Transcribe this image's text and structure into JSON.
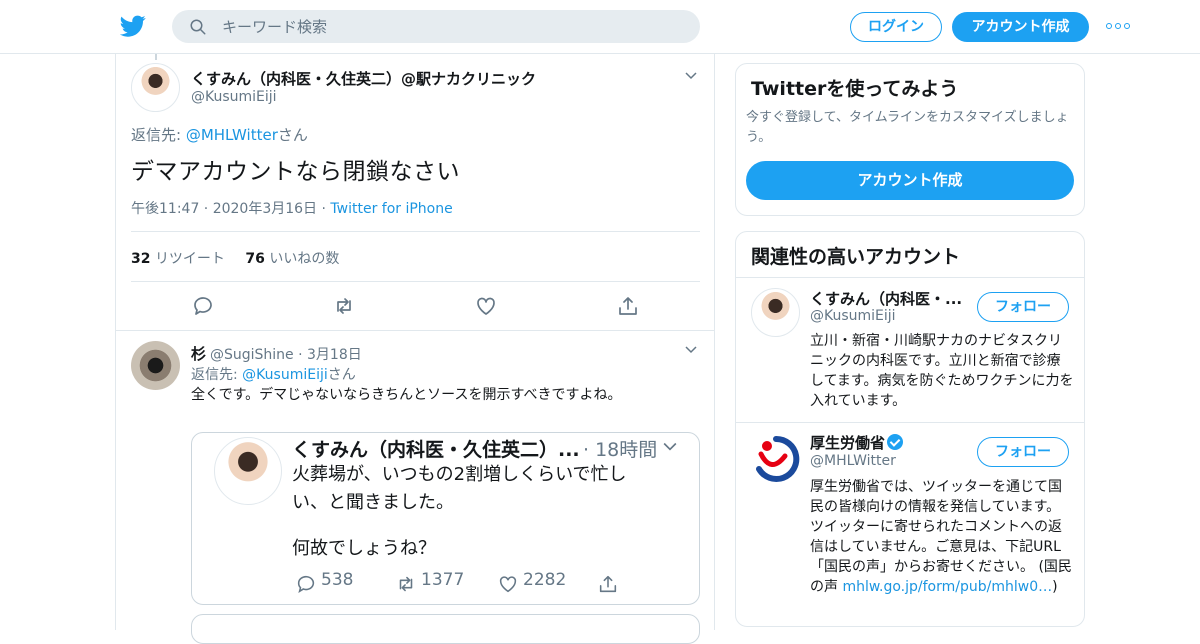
{
  "header": {
    "search_placeholder": "キーワード検索",
    "login_label": "ログイン",
    "signup_label": "アカウント作成",
    "more_icon": "more-icon"
  },
  "main_tweet": {
    "name": "くすみん（内科医・久住英二）@駅ナカクリニック",
    "handle": "@KusumiEiji",
    "reply_prefix": "返信先: ",
    "reply_to": "@MHLWitter",
    "reply_suffix": "さん",
    "text": "デマアカウントなら閉鎖なさい",
    "time": "午後11:47 · 2020年3月16日 · ",
    "source": "Twitter for iPhone",
    "retweets_count": "32",
    "retweets_label": "リツイート",
    "likes_count": "76",
    "likes_label": "いいねの数"
  },
  "reply_tweet": {
    "name": "杉",
    "handle": "@SugiShine",
    "date": "· 3月18日",
    "reply_prefix": "返信先: ",
    "reply_to": "@KusumiEiji",
    "reply_suffix": "さん",
    "text": "全くです。デマじゃないならきちんとソースを開示すべきですよね。",
    "embedded": {
      "name": "くすみん（内科医・久住英二）...",
      "time": "· 18時間",
      "line1": "火葬場が、いつもの2割増しくらいで忙し",
      "line2": "い、と聞きました。",
      "line3": "何故でしょうね？",
      "replies": "538",
      "retweets": "1377",
      "likes": "2282"
    }
  },
  "sidebar": {
    "signup_panel": {
      "title": "Twitterを使ってみよう",
      "description": "今すぐ登録して、タイムラインをカスタマイズしましょう。",
      "button": "アカウント作成"
    },
    "related_panel": {
      "title": "関連性の高いアカウント",
      "accounts": [
        {
          "name": "くすみん（内科医・...",
          "handle": "@KusumiEiji",
          "bio": "立川・新宿・川崎駅ナカのナビタスクリニックの内科医です。立川と新宿で診療してます。病気を防ぐためワクチンに力を入れています。",
          "follow": "フォロー"
        },
        {
          "name": "厚生労働省",
          "handle": "@MHLWitter",
          "bio": "厚生労働省では、ツイッターを通じて国民の皆様向けの情報を発信しています。ツイッターに寄せられたコメントへの返信はしていません。ご意見は、下記URL「国民の声」からお寄せください。 (国民の声 ",
          "bio_link": "mhlw.go.jp/form/pub/mhlw0…",
          "bio_end": ")",
          "follow": "フォロー"
        }
      ]
    }
  },
  "colors": {
    "accent": "#1da1f2",
    "link": "#1b95e0",
    "muted": "#657786",
    "border": "#e1e8ed"
  }
}
